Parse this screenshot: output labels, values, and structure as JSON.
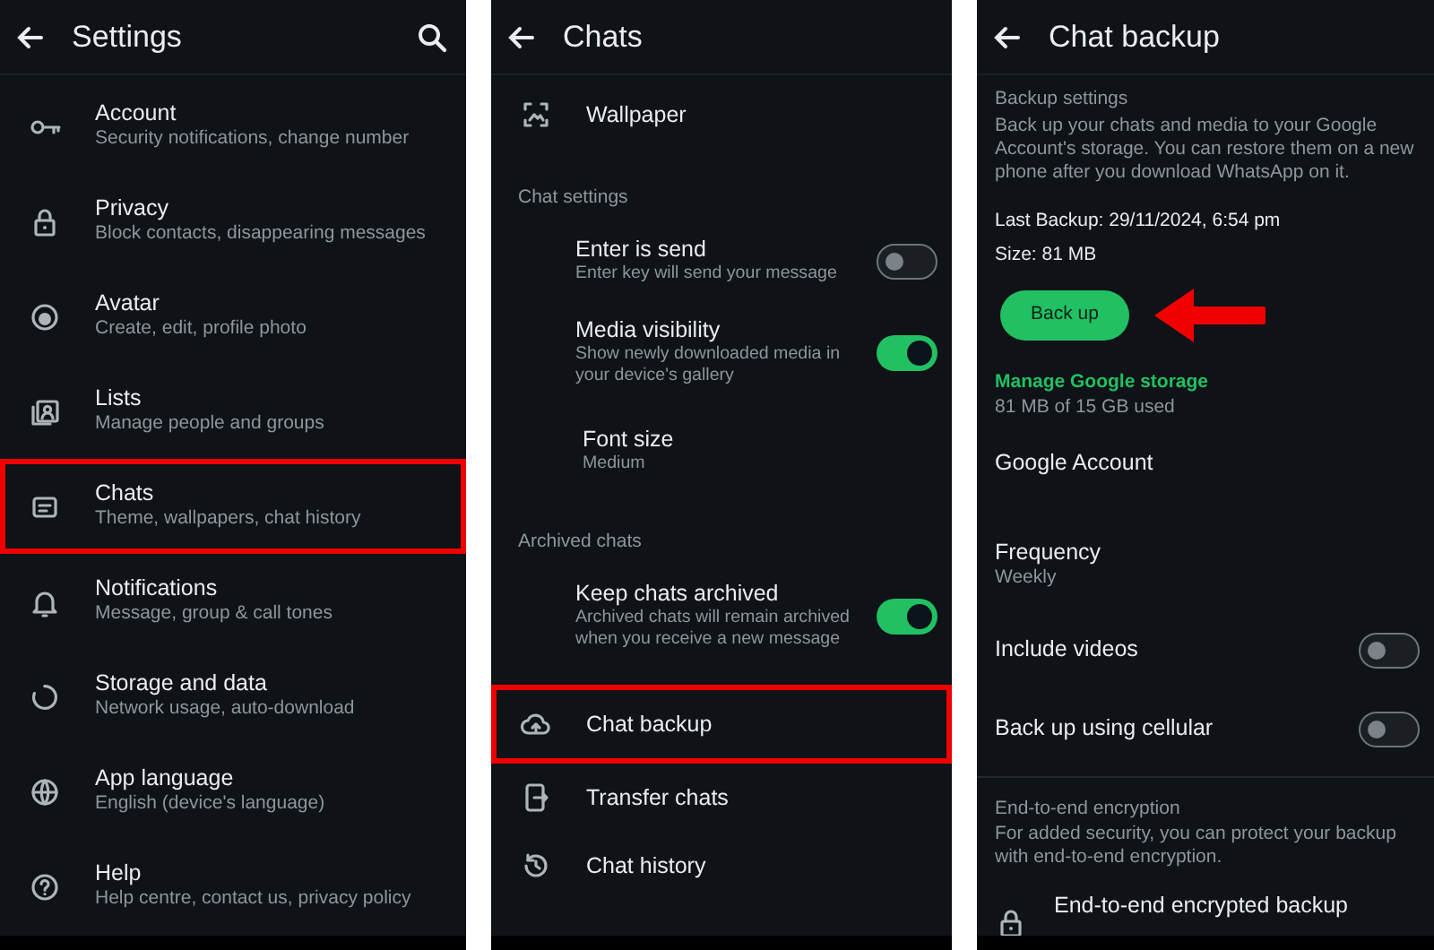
{
  "settings": {
    "title": "Settings",
    "items": [
      {
        "label": "Account",
        "sub": "Security notifications, change number",
        "highlighted": false
      },
      {
        "label": "Privacy",
        "sub": "Block contacts, disappearing messages",
        "highlighted": false
      },
      {
        "label": "Avatar",
        "sub": "Create, edit, profile photo",
        "highlighted": false
      },
      {
        "label": "Lists",
        "sub": "Manage people and groups",
        "highlighted": false
      },
      {
        "label": "Chats",
        "sub": "Theme, wallpapers, chat history",
        "highlighted": true
      },
      {
        "label": "Notifications",
        "sub": "Message, group & call tones",
        "highlighted": false
      },
      {
        "label": "Storage and data",
        "sub": "Network usage, auto-download",
        "highlighted": false
      },
      {
        "label": "App language",
        "sub": "English (device's language)",
        "highlighted": false
      },
      {
        "label": "Help",
        "sub": "Help centre, contact us, privacy policy",
        "highlighted": false
      }
    ]
  },
  "chats": {
    "title": "Chats",
    "items": [
      {
        "kind": "link",
        "label": "Wallpaper",
        "highlighted": false
      },
      {
        "kind": "header",
        "label": "Chat settings"
      },
      {
        "kind": "toggle",
        "label": "Enter is send",
        "sub": "Enter key will send your message",
        "on": false
      },
      {
        "kind": "toggle",
        "label": "Media visibility",
        "sub": "Show newly downloaded media in your device's gallery",
        "on": true
      },
      {
        "kind": "option",
        "label": "Font size",
        "sub": "Medium"
      },
      {
        "kind": "header",
        "label": "Archived chats"
      },
      {
        "kind": "toggle",
        "label": "Keep chats archived",
        "sub": "Archived chats will remain archived when you receive a new message",
        "on": true
      },
      {
        "kind": "link",
        "label": "Chat backup",
        "highlighted": true
      },
      {
        "kind": "link",
        "label": "Transfer chats",
        "highlighted": false
      },
      {
        "kind": "link",
        "label": "Chat history",
        "highlighted": false
      }
    ]
  },
  "chat_backup": {
    "title": "Chat backup",
    "section": "Backup settings",
    "description": "Back up your chats and media to your Google Account's storage. You can restore them on a new phone after you download WhatsApp on it.",
    "last_backup": "Last Backup: 29/11/2024, 6:54 pm",
    "size": "Size: 81 MB",
    "button": "Back up",
    "arrow": true,
    "manage_link": "Manage Google storage",
    "used": "81 MB of 15 GB used",
    "items": [
      {
        "kind": "option",
        "label": "Google Account"
      },
      {
        "kind": "option",
        "label": "Frequency",
        "sub": "Weekly"
      },
      {
        "kind": "toggle",
        "label": "Include videos",
        "on": false
      },
      {
        "kind": "toggle",
        "label": "Back up using cellular",
        "on": false
      }
    ],
    "encryption": {
      "section": "End-to-end encryption",
      "description": "For added security, you can protect your backup with end-to-end encryption.",
      "item": "End-to-end encrypted backup"
    }
  }
}
